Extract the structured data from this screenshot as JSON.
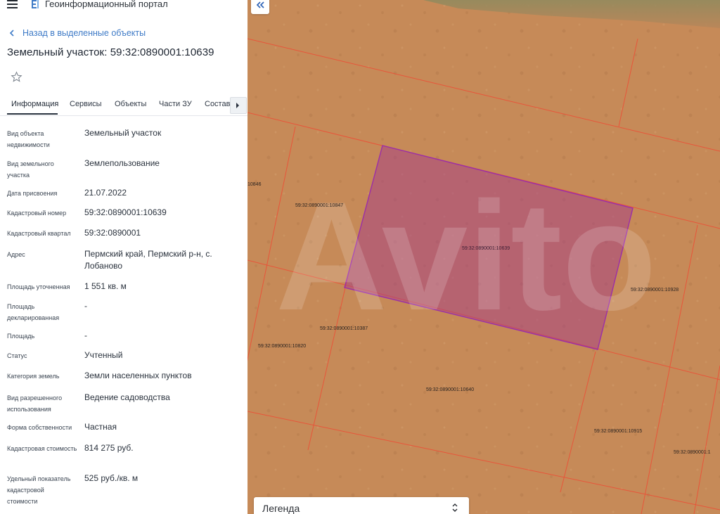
{
  "app": {
    "title": "Геоинформационный портал"
  },
  "nav": {
    "back_label": "Назад в выделенные объекты"
  },
  "page": {
    "title": "Земельный участок: 59:32:0890001:10639"
  },
  "tabs": [
    {
      "label": "Информация",
      "active": true
    },
    {
      "label": "Сервисы"
    },
    {
      "label": "Объекты"
    },
    {
      "label": "Части ЗУ"
    },
    {
      "label": "Состав"
    }
  ],
  "attributes": [
    {
      "label": "Вид объекта недвижимости",
      "value": "Земельный участок"
    },
    {
      "label": "Вид земельного участка",
      "value": "Землепользование"
    },
    {
      "label": "Дата присвоения",
      "value": "21.07.2022"
    },
    {
      "label": "Кадастровый номер",
      "value": "59:32:0890001:10639"
    },
    {
      "label": "Кадастровый квартал",
      "value": "59:32:0890001"
    },
    {
      "label": "Адрес",
      "value": "Пермский край, Пермский р-н, с. Лобаново"
    },
    {
      "label": "Площадь уточненная",
      "value": "1 551 кв. м"
    },
    {
      "label": "Площадь декларированная",
      "value": "-"
    },
    {
      "label": "Площадь",
      "value": "-"
    },
    {
      "label": "Статус",
      "value": "Учтенный"
    },
    {
      "label": "Категория земель",
      "value": "Земли населенных пунктов"
    },
    {
      "label": "Вид разрешенного использования",
      "value": "Ведение садоводства"
    },
    {
      "label": "Форма собственности",
      "value": "Частная"
    },
    {
      "label": "Кадастровая стоимость",
      "value": "814 275 руб."
    },
    {
      "label": "Удельный показатель кадастровой стоимости",
      "value": "525 руб./кв. м"
    }
  ],
  "map": {
    "parcel_labels": {
      "p10846": "10846",
      "p10847": "59:32:0890001:10847",
      "p10639": "59:32:0890001:10639",
      "p10928": "59:32:0890001:10928",
      "p10387": "59:32:0890001:10387",
      "p10820": "59:32:0890001:10820",
      "p10640": "59:32:0890001:10640",
      "p10915": "59:32:0890001:10915",
      "p_edge": "59:32:0890001:1"
    },
    "watermark": "Avito",
    "colors": {
      "boundary": "#e8553a",
      "selected": "#9b2ea8",
      "ground": "#c58a58"
    }
  },
  "legend": {
    "label": "Легенда"
  },
  "icons": {
    "menu": "menu-icon",
    "logo": "logo-icon",
    "back": "chevron-left-icon",
    "star": "star-icon",
    "tab_next": "chevron-right-icon",
    "collapse": "double-chevron-left-icon",
    "legend": "chevron-up-down-icon"
  }
}
